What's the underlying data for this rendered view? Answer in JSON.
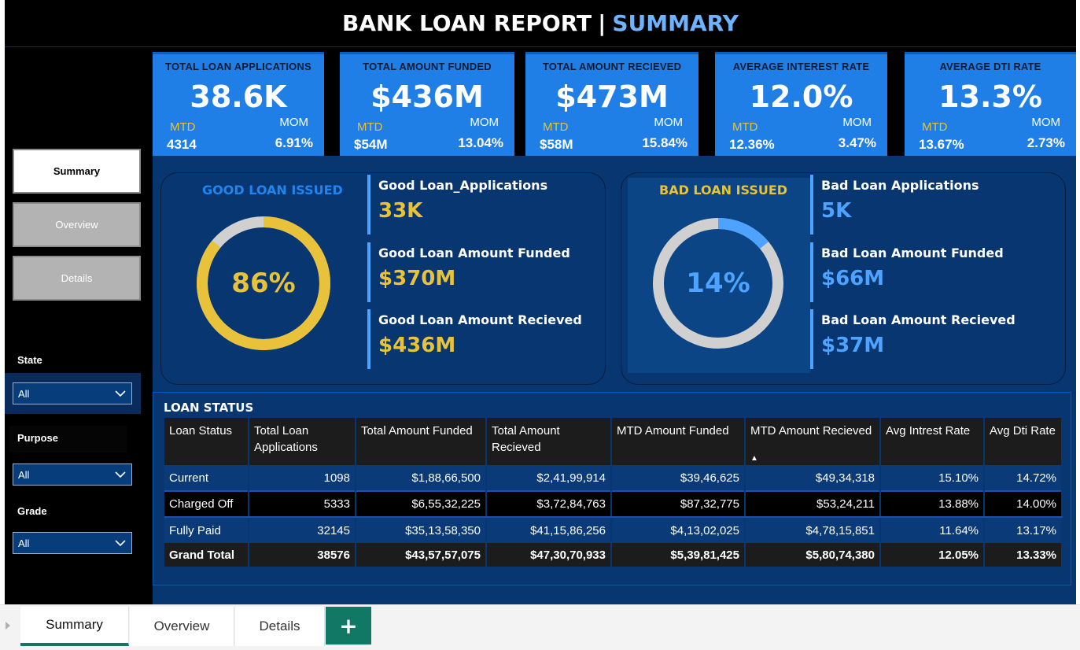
{
  "header": {
    "title_main": "BANK LOAN REPORT",
    "separator": "|",
    "title_accent": "SUMMARY"
  },
  "nav": [
    {
      "label": "Summary",
      "active": true
    },
    {
      "label": "Overview",
      "active": false
    },
    {
      "label": "Details",
      "active": false
    }
  ],
  "filters": [
    {
      "label": "State",
      "value": "All"
    },
    {
      "label": "Purpose",
      "value": "All"
    },
    {
      "label": "Grade",
      "value": "All"
    }
  ],
  "kpis": [
    {
      "title": "TOTAL LOAN APPLICATIONS",
      "value": "38.6K",
      "mtd_label": "MTD",
      "mom_label": "MOM",
      "mtd": "4314",
      "mom": "6.91%"
    },
    {
      "title": "TOTAL AMOUNT FUNDED",
      "value": "$436M",
      "mtd_label": "MTD",
      "mom_label": "MOM",
      "mtd": "$54M",
      "mom": "13.04%"
    },
    {
      "title": "TOTAL AMOUNT RECIEVED",
      "value": "$473M",
      "mtd_label": "MTD",
      "mom_label": "MOM",
      "mtd": "$58M",
      "mom": "15.84%"
    },
    {
      "title": "AVERAGE INTEREST RATE",
      "value": "12.0%",
      "mtd_label": "MTD",
      "mom_label": "MOM",
      "mtd": "12.36%",
      "mom": "3.47%"
    },
    {
      "title": "AVERAGE DTI RATE",
      "value": "13.3%",
      "mtd_label": "MTD",
      "mom_label": "MOM",
      "mtd": "13.67%",
      "mom": "2.73%"
    }
  ],
  "good_loan": {
    "title": "GOOD LOAN ISSUED",
    "percent_label": "86%",
    "percent": 0.86,
    "apps_label": "Good Loan_Applications",
    "apps_value": "33K",
    "funded_label": "Good Loan Amount Funded",
    "funded_value": "$370M",
    "received_label": "Good Loan Amount Recieved",
    "received_value": "$436M",
    "accent": "#e8c23b",
    "title_color": "#1f86f0"
  },
  "bad_loan": {
    "title": "BAD LOAN ISSUED",
    "percent_label": "14%",
    "percent": 0.14,
    "apps_label": "Bad Loan Applications",
    "apps_value": "5K",
    "funded_label": "Bad Loan Amount Funded",
    "funded_value": "$66M",
    "received_label": "Bad Loan Amount Recieved",
    "received_value": "$37M",
    "accent": "#4da3ff",
    "title_color": "#e8c23b"
  },
  "loan_status": {
    "title": "LOAN STATUS",
    "columns": [
      "Loan Status",
      "Total Loan Applications",
      "Total Amount Funded",
      "Total Amount Recieved",
      "MTD Amount Funded",
      "MTD Amount Recieved",
      "Avg Intrest Rate",
      "Avg Dti Rate"
    ],
    "sort_indicator": "▲",
    "rows": [
      [
        "Current",
        "1098",
        "$1,88,66,500",
        "$2,41,99,914",
        "$39,46,625",
        "$49,34,318",
        "15.10%",
        "14.72%"
      ],
      [
        "Charged Off",
        "5333",
        "$6,55,32,225",
        "$3,72,84,763",
        "$87,32,775",
        "$53,24,211",
        "13.88%",
        "14.00%"
      ],
      [
        "Fully Paid",
        "32145",
        "$35,13,58,350",
        "$41,15,86,256",
        "$4,13,02,025",
        "$4,78,15,851",
        "11.64%",
        "13.17%"
      ]
    ],
    "total": [
      "Grand Total",
      "38576",
      "$43,57,57,075",
      "$47,30,70,933",
      "$5,39,81,425",
      "$5,80,74,380",
      "12.05%",
      "13.33%"
    ]
  },
  "page_tabs": [
    {
      "label": "Summary",
      "active": true
    },
    {
      "label": "Overview",
      "active": false
    },
    {
      "label": "Details",
      "active": false
    }
  ],
  "add_tab_label": "+",
  "colors": {
    "brand_blue": "#1f7fe6",
    "panel": "#083670",
    "gold": "#e8c23b",
    "tab_green": "#117865"
  }
}
